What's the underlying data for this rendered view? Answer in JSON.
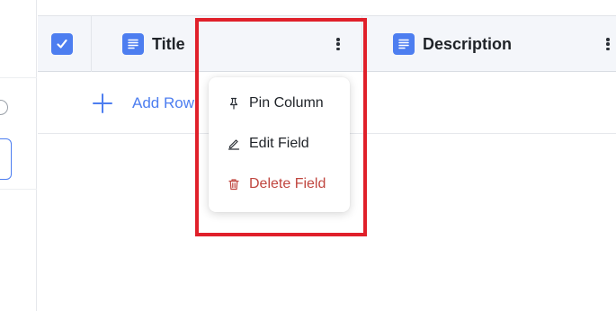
{
  "table": {
    "columns": [
      {
        "label": "Title",
        "type_icon": "text-lines-icon"
      },
      {
        "label": "Description",
        "type_icon": "text-lines-icon"
      }
    ],
    "add_row_label": "Add Row"
  },
  "column_menu": {
    "items": [
      {
        "label": "Pin Column",
        "icon": "pin-icon"
      },
      {
        "label": "Edit Field",
        "icon": "pencil-icon"
      },
      {
        "label": "Delete Field",
        "icon": "trash-icon"
      }
    ]
  },
  "colors": {
    "accent": "#4d7ef0",
    "danger": "#c0463f",
    "highlight": "#e0202a",
    "header_bg": "#f4f6fa"
  }
}
